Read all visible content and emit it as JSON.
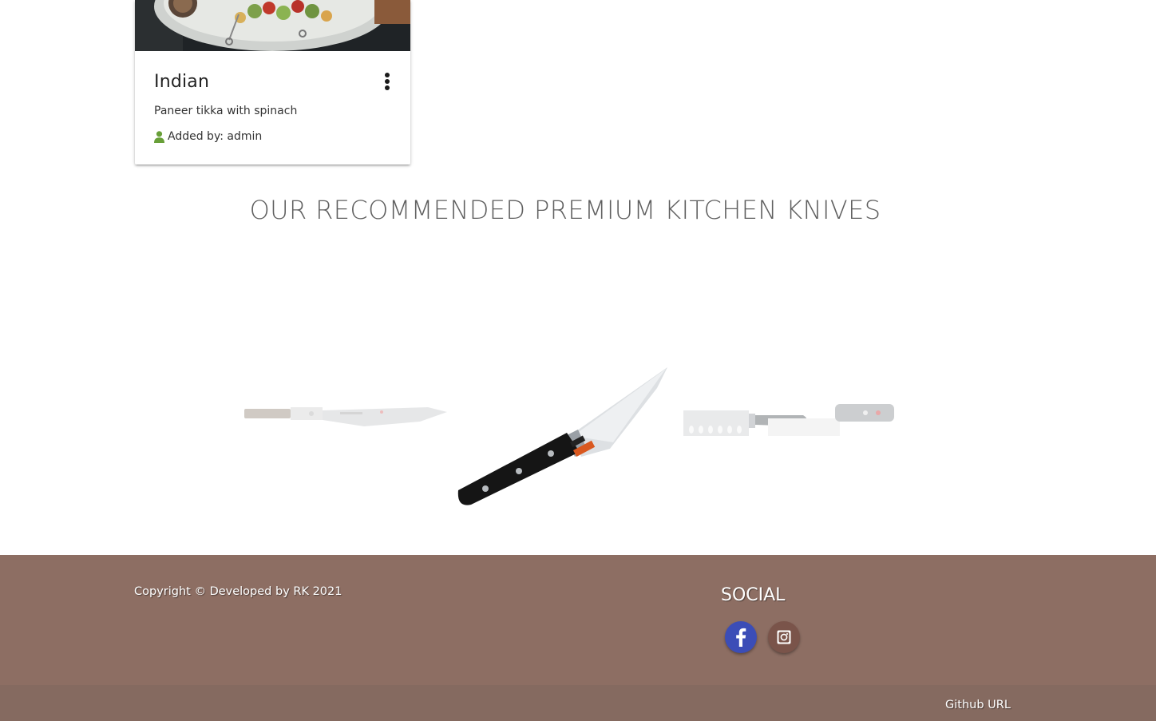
{
  "card": {
    "title": "Indian",
    "description": "Paneer tikka with spinach",
    "author": "Added by: admin",
    "icons": {
      "menu": "more-vert-icon",
      "author": "user-icon"
    },
    "colors": {
      "author_icon": "#689f38"
    }
  },
  "section": {
    "title": "OUR RECOMMENDED PREMIUM KITCHEN KNIVES"
  },
  "carousel": {
    "items": [
      {
        "name": "utility-knife"
      },
      {
        "name": "boning-knife"
      },
      {
        "name": "nakiri-cleaver-knife"
      }
    ],
    "active_index": 1
  },
  "footer": {
    "copyright": "Copyright © Developed by RK 2021",
    "social_title": "SOCIAL",
    "social_icons": [
      "facebook-icon",
      "instagram-icon"
    ],
    "github": "Github URL",
    "colors": {
      "background": "#8d6e63",
      "bottom": "#856a60",
      "facebook": "#3b4db7",
      "instagram": "#7a544a"
    }
  }
}
